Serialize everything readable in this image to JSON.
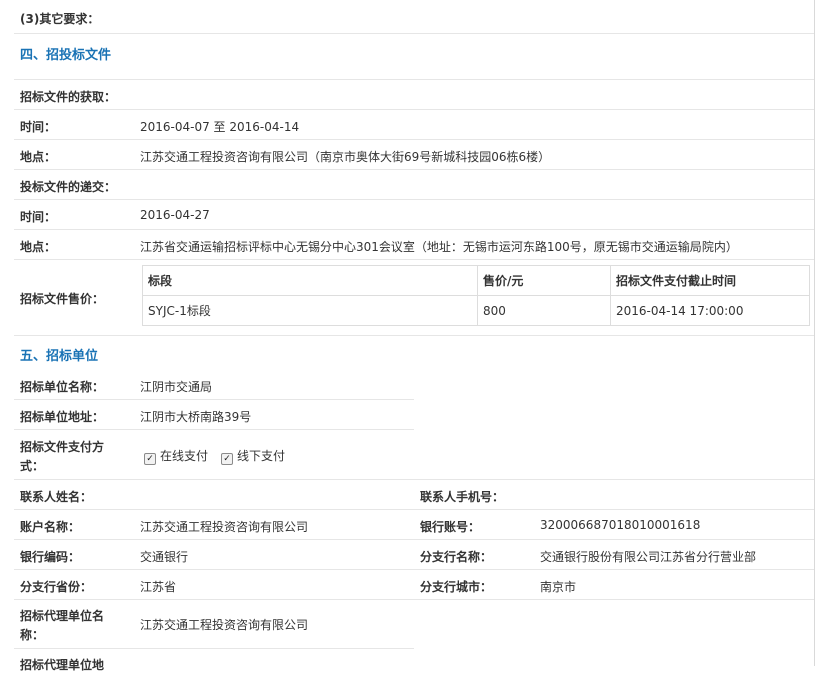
{
  "s3": "(3)其它要求：",
  "s4": "四、招投标文件",
  "obtain_label": "招标文件的获取：",
  "time_label": "时间：",
  "obtain_time": "2016-04-07 至 2016-04-14",
  "place_label": "地点：",
  "obtain_place": "江苏交通工程投资咨询有限公司（南京市奥体大街69号新城科技园06栋6楼）",
  "submit_label": "投标文件的递交：",
  "submit_time": "2016-04-27",
  "submit_place": "江苏省交通运输招标评标中心无锡分中心301会议室（地址：无锡市运河东路100号，原无锡市交通运输局院内）",
  "sale_label": "招标文件售价：",
  "table": {
    "h1": "标段",
    "h2": "售价/元",
    "h3": "招标文件支付截止时间",
    "r1c1": "SYJC-1标段",
    "r1c2": "800",
    "r1c3": "2016-04-14 17:00:00"
  },
  "s5": "五、招标单位",
  "unit_name_label": "招标单位名称：",
  "unit_name": "江阴市交通局",
  "unit_addr_label": "招标单位地址：",
  "unit_addr": "江阴市大桥南路39号",
  "pay_label_1": "招标文件支付方",
  "pay_label_2": "式：",
  "pay_online": "在线支付",
  "pay_offline": "线下支付",
  "contact_label": "联系人姓名：",
  "phone_label": "联系人手机号：",
  "acct_name_label": "账户名称：",
  "acct_name": "江苏交通工程投资咨询有限公司",
  "bank_acct_label": "银行账号：",
  "bank_acct": "32000668701801000161​8",
  "bank_code_label": "银行编码：",
  "bank_code": "交通银行",
  "branch_label": "分支行名称：",
  "branch": "交通银行股份有限公司江苏省分行营业部",
  "prov_label": "分支行省份：",
  "prov": "江苏省",
  "city_label": "分支行城市：",
  "city": "南京市",
  "agent_label_1": "招标代理单位名",
  "agent_label_2": "称：",
  "agent_name": "江苏交通工程投资咨询有限公司",
  "agent_addr_label": "招标代理单位地"
}
